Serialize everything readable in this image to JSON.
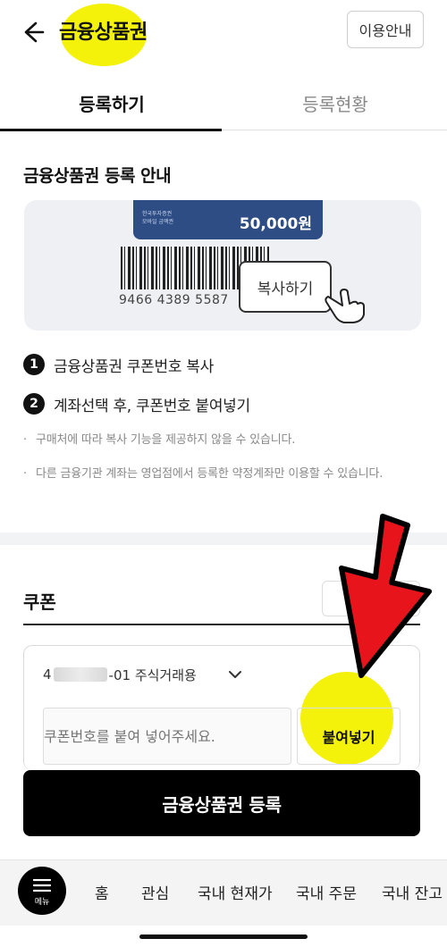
{
  "header": {
    "title": "금융상품권",
    "guide_label": "이용안내"
  },
  "tabs": [
    {
      "label": "등록하기"
    },
    {
      "label": "등록현황"
    }
  ],
  "guide": {
    "title": "금융상품권 등록 안내",
    "card_small_text": "한국투자증권\n모바일 금액권",
    "card_amount": "50,000원",
    "barcode_number": "9466 4389 5587",
    "copy_label": "복사하기"
  },
  "steps": [
    {
      "num": "1",
      "text": "금융상품권 쿠폰번호 복사"
    },
    {
      "num": "2",
      "text": "계좌선택 후, 쿠폰번호 붙여넣기"
    }
  ],
  "notes": [
    "구매처에 따라 복사 기능을 제공하지 않을 수 있습니다.",
    "다른 금융기관 계좌는 영업점에서 등록한 약정계좌만 이용할 수 있습니다."
  ],
  "coupon": {
    "title": "쿠폰",
    "add_label": "+",
    "account_prefix": "4",
    "account_suffix": "-01 주식거래용",
    "input_placeholder": "쿠폰번호를 붙여 넣어주세요.",
    "paste_label": "붙여넣기"
  },
  "register_label": "금융상품권 등록",
  "bottom_nav": {
    "menu_label": "메뉴",
    "items": [
      "홈",
      "관심",
      "국내 현재가",
      "국내 주문",
      "국내 잔고"
    ]
  },
  "colors": {
    "highlight": "#f4f10a",
    "arrow": "#e8141c",
    "card": "#2e4d85"
  }
}
